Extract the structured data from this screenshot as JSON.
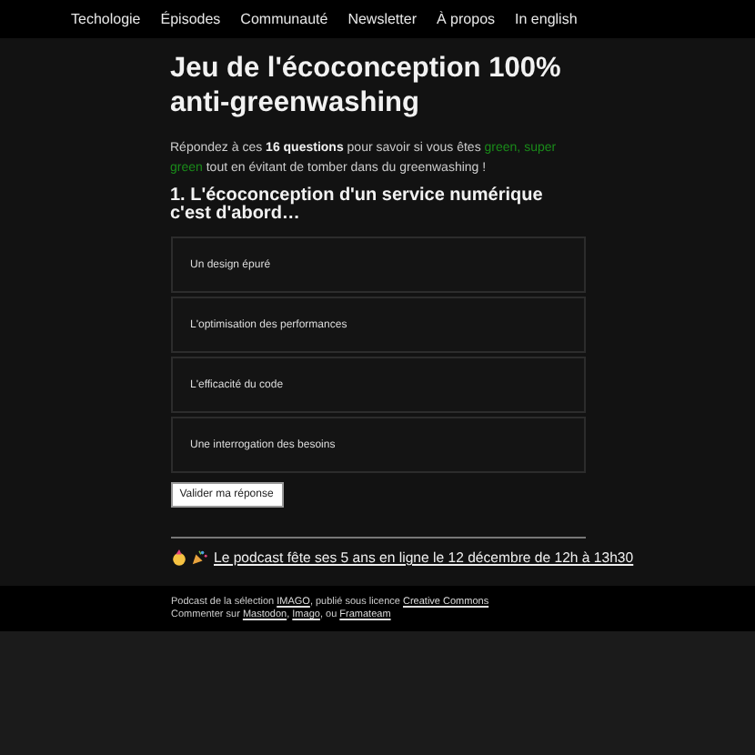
{
  "nav": [
    {
      "label": "Techologie"
    },
    {
      "label": "Épisodes"
    },
    {
      "label": "Communauté"
    },
    {
      "label": "Newsletter"
    },
    {
      "label": "À propos"
    },
    {
      "label": "In english"
    }
  ],
  "title": "Jeu de l'écoconception 100% anti-greenwashing",
  "intro": [
    {
      "text": "Répondez à ces ",
      "kind": "text"
    },
    {
      "text": "16 questions",
      "kind": "emphasis"
    },
    {
      "text": " pour savoir si vous êtes ",
      "kind": "text"
    },
    {
      "text": "green, super green",
      "kind": "highlight"
    },
    {
      "text": " tout en évitant de tomber dans du greenwashing !",
      "kind": "text"
    }
  ],
  "question": "1. L'écoconception d'un service numérique c'est d'abord…",
  "options": [
    {
      "label": "Un design épuré",
      "selected": false
    },
    {
      "label": "L'optimisation des performances",
      "selected": false
    },
    {
      "label": "L'efficacité du code",
      "selected": false
    },
    {
      "label": "Une interrogation des besoins",
      "selected": false
    }
  ],
  "submit": "Valider ma réponse",
  "announcement": "Le podcast fête ses 5 ans en ligne le 12 décembre de 12h à 13h30",
  "footer": [
    [
      {
        "text": "Podcast de la sélection ",
        "kind": "text"
      },
      {
        "text": "IMAGO",
        "kind": "link"
      },
      {
        "text": ", publié sous licence ",
        "kind": "text"
      },
      {
        "text": "Creative Commons",
        "kind": "link"
      }
    ],
    [
      {
        "text": "Commenter sur ",
        "kind": "text"
      },
      {
        "text": "Mastodon",
        "kind": "link"
      },
      {
        "text": ", ",
        "kind": "text"
      },
      {
        "text": "Imago",
        "kind": "link"
      },
      {
        "text": ", ou ",
        "kind": "text"
      },
      {
        "text": "Framateam",
        "kind": "link"
      }
    ]
  ]
}
